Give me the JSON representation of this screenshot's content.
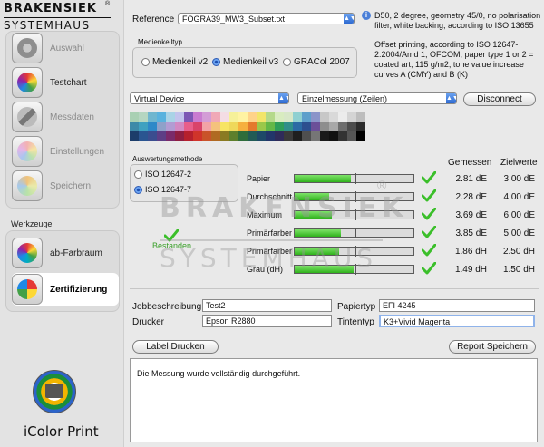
{
  "brand": {
    "line1": "BRAKENSIEK",
    "line2": "SYSTEMHAUS",
    "reg": "®"
  },
  "sidebar": {
    "items": [
      {
        "label": "Auswahl",
        "icon": "globe-icon"
      },
      {
        "label": "Testchart",
        "icon": "colorwheel-icon"
      },
      {
        "label": "Messdaten",
        "icon": "measure-icon"
      },
      {
        "label": "Einstellungen",
        "icon": "settings-icon"
      },
      {
        "label": "Speichern",
        "icon": "save-icon"
      }
    ],
    "tools_heading": "Werkzeuge",
    "tools": [
      {
        "label": "ab-Farbraum",
        "icon": "colorspace-icon"
      },
      {
        "label": "Zertifizierung",
        "icon": "certificate-icon"
      }
    ],
    "app_name": "iColor Print"
  },
  "reference": {
    "label": "Reference",
    "value": "FOGRA39_MW3_Subset.txt"
  },
  "medienkeil": {
    "title": "Medienkeiltyp",
    "options": [
      "Medienkeil v2",
      "Medienkeil v3",
      "GRACol 2007"
    ],
    "selected": "Medienkeil v3"
  },
  "info_text": {
    "para1": "D50, 2 degree, geometry 45/0, no polarisation filter, white backing, according to ISO 13655",
    "para2": "Offset printing, according to ISO 12647-2:2004/Amd 1, OFCOM, paper type 1 or 2 = coated art, 115 g/m2, tone value increase curves A (CMY) and B (K)"
  },
  "device": {
    "device_value": "Virtual Device",
    "mode_value": "Einzelmessung (Zeilen)",
    "disconnect_label": "Disconnect"
  },
  "auswertung": {
    "title": "Auswertungsmethode",
    "options": [
      "ISO 12647-2",
      "ISO 12647-7"
    ],
    "selected": "ISO 12647-7",
    "status": "Bestanden"
  },
  "results": {
    "col_measured": "Gemessen",
    "col_target": "Zielwerte",
    "rows": [
      {
        "label": "Papier",
        "measured": "2.81 dE",
        "target": "3.00 dE",
        "level": 0.94
      },
      {
        "label": "Durchschnitt",
        "measured": "2.28 dE",
        "target": "4.00 dE",
        "level": 0.57
      },
      {
        "label": "Maximum",
        "measured": "3.69 dE",
        "target": "6.00 dE",
        "level": 0.62
      },
      {
        "label": "Primärfarben",
        "measured": "3.85 dE",
        "target": "5.00 dE",
        "level": 0.77
      },
      {
        "label": "Primärfarben",
        "measured": "1.86 dH",
        "target": "2.50 dH",
        "level": 0.74
      },
      {
        "label": "Grau (dH)",
        "measured": "1.49 dH",
        "target": "1.50 dH",
        "level": 0.99
      }
    ]
  },
  "watermark": {
    "line1": "BRAKENSIEK",
    "line2": "SYSTEMHAUS",
    "reg": "®"
  },
  "job": {
    "job_label": "Jobbeschreibung",
    "job_value": "Test2",
    "printer_label": "Drucker",
    "printer_value": "Epson R2880",
    "paper_label": "Papiertyp",
    "paper_value": "EFI 4245",
    "ink_label": "Tintentyp",
    "ink_value": "K3+Vivid Magenta"
  },
  "actions": {
    "label_print": "Label Drucken",
    "report_save": "Report Speichern"
  },
  "message": "Die Messung wurde vollständig durchgeführt.",
  "colors": {
    "accent_blue": "#2e6ad1",
    "bar_green": "#2fb21b",
    "check_green": "#3bbf2a"
  }
}
